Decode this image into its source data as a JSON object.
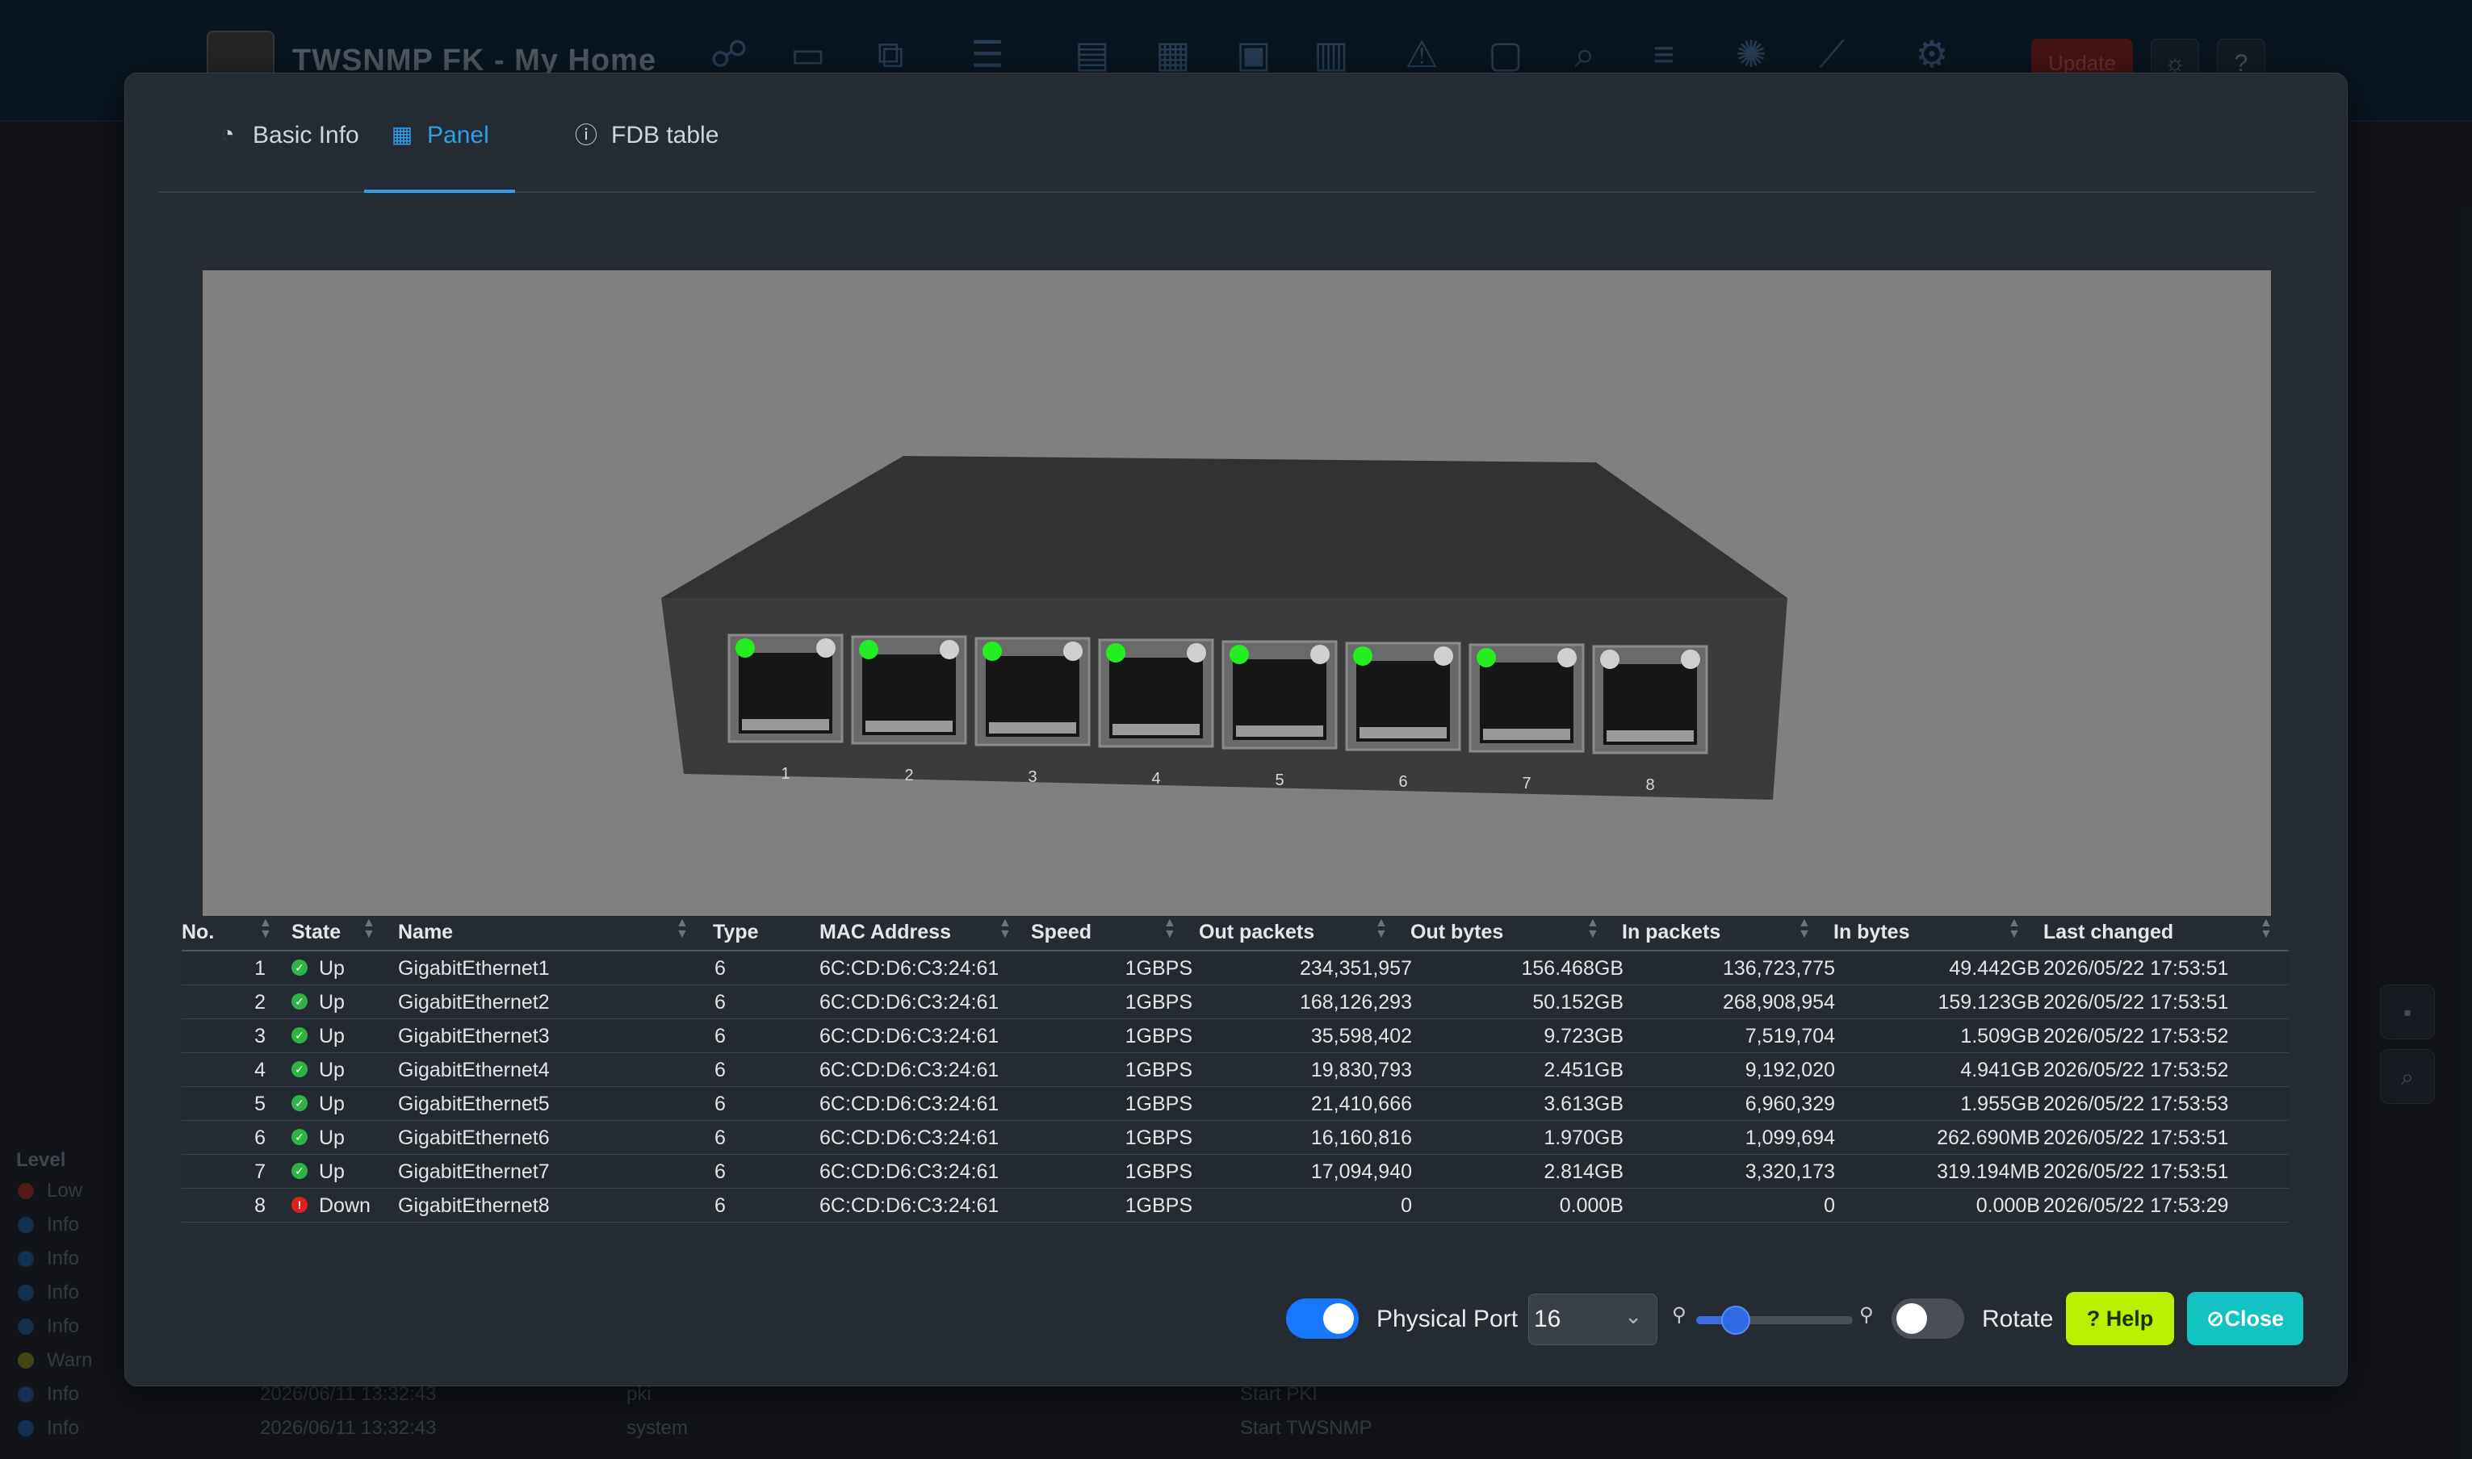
{
  "app": {
    "title": "TWSNMP FK - My Home",
    "update_label": "Update"
  },
  "log": {
    "level_header": "Level",
    "rows": [
      {
        "level": "Low",
        "time": "",
        "type": "",
        "message": "",
        "color": "#7a2a2a"
      },
      {
        "level": "Info",
        "time": "",
        "type": "",
        "message": "",
        "color": "#1e4a7a"
      },
      {
        "level": "Info",
        "time": "",
        "type": "",
        "message": "",
        "color": "#1e4a7a"
      },
      {
        "level": "Info",
        "time": "",
        "type": "",
        "message": "",
        "color": "#1e4a7a"
      },
      {
        "level": "Info",
        "time": "",
        "type": "",
        "message": "",
        "color": "#1e4a7a"
      },
      {
        "level": "Warn",
        "time": "",
        "type": "",
        "message": "",
        "color": "#6a6a2a"
      },
      {
        "level": "Info",
        "time": "2026/06/11 13:32:43",
        "type": "pki",
        "message": "Start PKI",
        "color": "#1e4a7a"
      },
      {
        "level": "Info",
        "time": "2026/06/11 13:32:43",
        "type": "system",
        "message": "Start TWSNMP",
        "color": "#1e4a7a"
      }
    ]
  },
  "tabs": [
    {
      "label": "Basic Info",
      "icon": "pie-chart-icon",
      "active": false
    },
    {
      "label": "Panel",
      "icon": "table-grid-icon",
      "active": true
    },
    {
      "label": "FDB table",
      "icon": "info-circle-icon",
      "active": false
    }
  ],
  "panel": {
    "port_labels": [
      "1",
      "2",
      "3",
      "4",
      "5",
      "6",
      "7",
      "8"
    ],
    "port_link_leds": [
      "on",
      "on",
      "on",
      "on",
      "on",
      "on",
      "on",
      "off"
    ],
    "led_on_color": "#22ee22",
    "led_off_color": "#d0d0d0"
  },
  "table": {
    "headers": [
      "No.",
      "State",
      "Name",
      "Type",
      "MAC Address",
      "Speed",
      "Out packets",
      "Out bytes",
      "In packets",
      "In bytes",
      "Last changed"
    ],
    "rows": [
      {
        "no": "1",
        "state": "Up",
        "name": "GigabitEthernet1",
        "type": "6",
        "mac": "6C:CD:D6:C3:24:61",
        "speed": "1GBPS",
        "out_packets": "234,351,957",
        "out_bytes": "156.468GB",
        "in_packets": "136,723,775",
        "in_bytes": "49.442GB",
        "last_changed": "2026/05/22 17:53:51"
      },
      {
        "no": "2",
        "state": "Up",
        "name": "GigabitEthernet2",
        "type": "6",
        "mac": "6C:CD:D6:C3:24:61",
        "speed": "1GBPS",
        "out_packets": "168,126,293",
        "out_bytes": "50.152GB",
        "in_packets": "268,908,954",
        "in_bytes": "159.123GB",
        "last_changed": "2026/05/22 17:53:51"
      },
      {
        "no": "3",
        "state": "Up",
        "name": "GigabitEthernet3",
        "type": "6",
        "mac": "6C:CD:D6:C3:24:61",
        "speed": "1GBPS",
        "out_packets": "35,598,402",
        "out_bytes": "9.723GB",
        "in_packets": "7,519,704",
        "in_bytes": "1.509GB",
        "last_changed": "2026/05/22 17:53:52"
      },
      {
        "no": "4",
        "state": "Up",
        "name": "GigabitEthernet4",
        "type": "6",
        "mac": "6C:CD:D6:C3:24:61",
        "speed": "1GBPS",
        "out_packets": "19,830,793",
        "out_bytes": "2.451GB",
        "in_packets": "9,192,020",
        "in_bytes": "4.941GB",
        "last_changed": "2026/05/22 17:53:52"
      },
      {
        "no": "5",
        "state": "Up",
        "name": "GigabitEthernet5",
        "type": "6",
        "mac": "6C:CD:D6:C3:24:61",
        "speed": "1GBPS",
        "out_packets": "21,410,666",
        "out_bytes": "3.613GB",
        "in_packets": "6,960,329",
        "in_bytes": "1.955GB",
        "last_changed": "2026/05/22 17:53:53"
      },
      {
        "no": "6",
        "state": "Up",
        "name": "GigabitEthernet6",
        "type": "6",
        "mac": "6C:CD:D6:C3:24:61",
        "speed": "1GBPS",
        "out_packets": "16,160,816",
        "out_bytes": "1.970GB",
        "in_packets": "1,099,694",
        "in_bytes": "262.690MB",
        "last_changed": "2026/05/22 17:53:51"
      },
      {
        "no": "7",
        "state": "Up",
        "name": "GigabitEthernet7",
        "type": "6",
        "mac": "6C:CD:D6:C3:24:61",
        "speed": "1GBPS",
        "out_packets": "17,094,940",
        "out_bytes": "2.814GB",
        "in_packets": "3,320,173",
        "in_bytes": "319.194MB",
        "last_changed": "2026/05/22 17:53:51"
      },
      {
        "no": "8",
        "state": "Down",
        "name": "GigabitEthernet8",
        "type": "6",
        "mac": "6C:CD:D6:C3:24:61",
        "speed": "1GBPS",
        "out_packets": "0",
        "out_bytes": "0.000B",
        "in_packets": "0",
        "in_bytes": "0.000B",
        "last_changed": "2026/05/22 17:53:29"
      }
    ],
    "state_colors": {
      "Up": "#2fb344",
      "Down": "#e02020"
    }
  },
  "footer": {
    "physical_port_toggle_on": true,
    "physical_port_label": "Physical Port",
    "port_count_value": "16",
    "zoom_level": 0.25,
    "rotate_toggle_on": false,
    "rotate_label": "Rotate",
    "help_label": "Help",
    "close_label": "Close",
    "help_color": "#b8f000",
    "close_color": "#13c2c2",
    "toggle_on_color": "#1677ff",
    "toggle_off_color": "#4a4f57"
  }
}
